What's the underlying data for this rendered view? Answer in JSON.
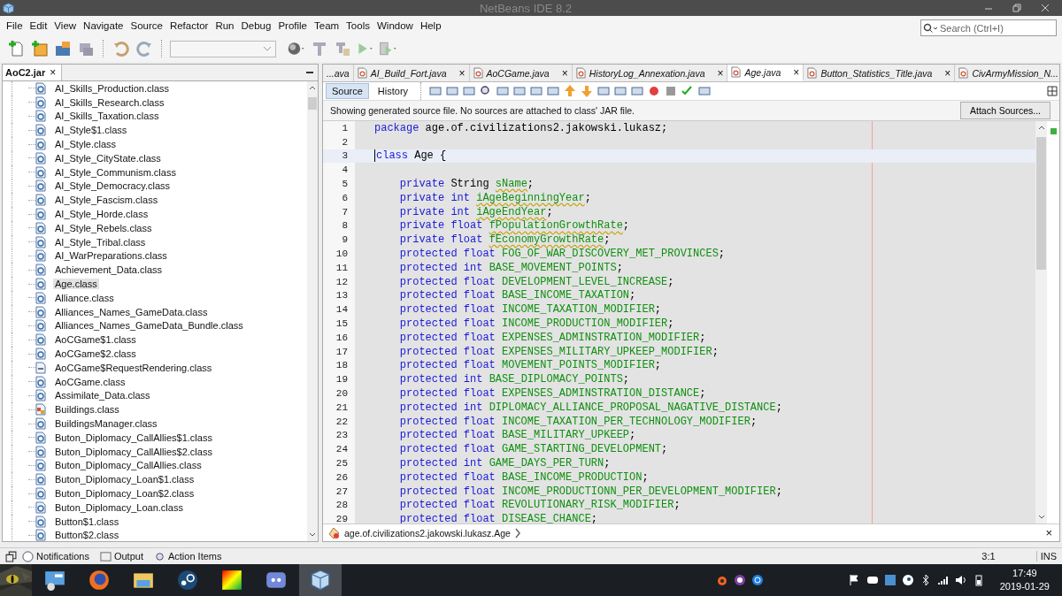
{
  "window": {
    "title": "NetBeans IDE 8.2"
  },
  "menu": [
    "File",
    "Edit",
    "View",
    "Navigate",
    "Source",
    "Refactor",
    "Run",
    "Debug",
    "Profile",
    "Team",
    "Tools",
    "Window",
    "Help"
  ],
  "search": {
    "placeholder": "Search (Ctrl+I)"
  },
  "project_panel": {
    "tab": "AoC2.jar",
    "close": "×",
    "items": [
      {
        "label": "AI_Skills_Production.class",
        "kind": "class",
        "selected": false
      },
      {
        "label": "AI_Skills_Research.class",
        "kind": "class",
        "selected": false
      },
      {
        "label": "AI_Skills_Taxation.class",
        "kind": "class",
        "selected": false
      },
      {
        "label": "AI_Style$1.class",
        "kind": "class",
        "selected": false
      },
      {
        "label": "AI_Style.class",
        "kind": "class",
        "selected": false
      },
      {
        "label": "AI_Style_CityState.class",
        "kind": "class",
        "selected": false
      },
      {
        "label": "AI_Style_Communism.class",
        "kind": "class",
        "selected": false
      },
      {
        "label": "AI_Style_Democracy.class",
        "kind": "class",
        "selected": false
      },
      {
        "label": "AI_Style_Fascism.class",
        "kind": "class",
        "selected": false
      },
      {
        "label": "AI_Style_Horde.class",
        "kind": "class",
        "selected": false
      },
      {
        "label": "AI_Style_Rebels.class",
        "kind": "class",
        "selected": false
      },
      {
        "label": "AI_Style_Tribal.class",
        "kind": "class",
        "selected": false
      },
      {
        "label": "AI_WarPreparations.class",
        "kind": "class",
        "selected": false
      },
      {
        "label": "Achievement_Data.class",
        "kind": "class",
        "selected": false
      },
      {
        "label": "Age.class",
        "kind": "class",
        "selected": true
      },
      {
        "label": "Alliance.class",
        "kind": "class",
        "selected": false
      },
      {
        "label": "Alliances_Names_GameData.class",
        "kind": "class",
        "selected": false
      },
      {
        "label": "Alliances_Names_GameData_Bundle.class",
        "kind": "class",
        "selected": false
      },
      {
        "label": "AoCGame$1.class",
        "kind": "class",
        "selected": false
      },
      {
        "label": "AoCGame$2.class",
        "kind": "class",
        "selected": false
      },
      {
        "label": "AoCGame$RequestRendering.class",
        "kind": "interface",
        "selected": false
      },
      {
        "label": "AoCGame.class",
        "kind": "class",
        "selected": false
      },
      {
        "label": "Assimilate_Data.class",
        "kind": "class",
        "selected": false
      },
      {
        "label": "Buildings.class",
        "kind": "enum",
        "selected": false
      },
      {
        "label": "BuildingsManager.class",
        "kind": "class",
        "selected": false
      },
      {
        "label": "Buton_Diplomacy_CallAllies$1.class",
        "kind": "class",
        "selected": false
      },
      {
        "label": "Buton_Diplomacy_CallAllies$2.class",
        "kind": "class",
        "selected": false
      },
      {
        "label": "Buton_Diplomacy_CallAllies.class",
        "kind": "class",
        "selected": false
      },
      {
        "label": "Buton_Diplomacy_Loan$1.class",
        "kind": "class",
        "selected": false
      },
      {
        "label": "Buton_Diplomacy_Loan$2.class",
        "kind": "class",
        "selected": false
      },
      {
        "label": "Buton_Diplomacy_Loan.class",
        "kind": "class",
        "selected": false
      },
      {
        "label": "Button$1.class",
        "kind": "class",
        "selected": false
      },
      {
        "label": "Button$2.class",
        "kind": "class",
        "selected": false
      }
    ]
  },
  "editor": {
    "tabs": [
      {
        "label": "...ava",
        "file": false,
        "selected": false
      },
      {
        "label": "AI_Build_Fort.java",
        "file": true,
        "selected": false
      },
      {
        "label": "AoCGame.java",
        "file": true,
        "selected": false
      },
      {
        "label": "HistoryLog_Annexation.java",
        "file": true,
        "selected": false
      },
      {
        "label": "Age.java",
        "file": true,
        "selected": true
      },
      {
        "label": "Button_Statistics_Title.java",
        "file": true,
        "selected": false
      },
      {
        "label": "CivArmyMission_N...",
        "file": true,
        "selected": false
      }
    ],
    "tab_close": "×",
    "views": [
      {
        "label": "Source",
        "selected": true
      },
      {
        "label": "History",
        "selected": false
      }
    ],
    "notice": "Showing generated source file. No sources are attached to class' JAR file.",
    "attach_button": "Attach Sources...",
    "lines": [
      {
        "num": "1",
        "indented": false,
        "current": false,
        "tokens": [
          {
            "kind": "keyword",
            "text": "package "
          },
          {
            "kind": "plain",
            "text": "age.of.civilizations2.jakowski.lukasz;"
          }
        ]
      },
      {
        "num": "2",
        "current": false
      },
      {
        "num": "3",
        "indented": false,
        "current": true,
        "tokens": [
          {
            "kind": "keyword",
            "text": "class "
          },
          {
            "kind": "plain",
            "text": "Age {"
          }
        ]
      },
      {
        "num": "4",
        "current": false
      },
      {
        "num": "5",
        "indented": true,
        "current": false,
        "tokens": [
          {
            "kind": "keyword",
            "text": "private "
          },
          {
            "kind": "plain",
            "text": "String "
          },
          {
            "kind": "field",
            "text": "sName",
            "warning": true
          },
          {
            "kind": "plain",
            "text": ";"
          }
        ]
      },
      {
        "num": "6",
        "indented": true,
        "current": false,
        "tokens": [
          {
            "kind": "keyword",
            "text": "private int "
          },
          {
            "kind": "field",
            "text": "iAgeBeginningYear",
            "warning": true
          },
          {
            "kind": "plain",
            "text": ";"
          }
        ]
      },
      {
        "num": "7",
        "indented": true,
        "current": false,
        "tokens": [
          {
            "kind": "keyword",
            "text": "private int "
          },
          {
            "kind": "field",
            "text": "iAgeEndYear",
            "warning": true
          },
          {
            "kind": "plain",
            "text": ";"
          }
        ]
      },
      {
        "num": "8",
        "indented": true,
        "current": false,
        "tokens": [
          {
            "kind": "keyword",
            "text": "private float "
          },
          {
            "kind": "field",
            "text": "fPopulationGrowthRate",
            "warning": true
          },
          {
            "kind": "plain",
            "text": ";"
          }
        ]
      },
      {
        "num": "9",
        "indented": true,
        "current": false,
        "tokens": [
          {
            "kind": "keyword",
            "text": "private float "
          },
          {
            "kind": "field",
            "text": "fEconomyGrowthRate",
            "warning": true
          },
          {
            "kind": "plain",
            "text": ";"
          }
        ]
      },
      {
        "num": "10",
        "indented": true,
        "current": false,
        "tokens": [
          {
            "kind": "keyword",
            "text": "protected float "
          },
          {
            "kind": "field",
            "text": "FOG_OF_WAR_DISCOVERY_MET_PROVINCES",
            "warning": false
          },
          {
            "kind": "plain",
            "text": ";"
          }
        ]
      },
      {
        "num": "11",
        "indented": true,
        "current": false,
        "tokens": [
          {
            "kind": "keyword",
            "text": "protected int "
          },
          {
            "kind": "field",
            "text": "BASE_MOVEMENT_POINTS",
            "warning": false
          },
          {
            "kind": "plain",
            "text": ";"
          }
        ]
      },
      {
        "num": "12",
        "indented": true,
        "current": false,
        "tokens": [
          {
            "kind": "keyword",
            "text": "protected float "
          },
          {
            "kind": "field",
            "text": "DEVELOPMENT_LEVEL_INCREASE",
            "warning": false
          },
          {
            "kind": "plain",
            "text": ";"
          }
        ]
      },
      {
        "num": "13",
        "indented": true,
        "current": false,
        "tokens": [
          {
            "kind": "keyword",
            "text": "protected float "
          },
          {
            "kind": "field",
            "text": "BASE_INCOME_TAXATION",
            "warning": false
          },
          {
            "kind": "plain",
            "text": ";"
          }
        ]
      },
      {
        "num": "14",
        "indented": true,
        "current": false,
        "tokens": [
          {
            "kind": "keyword",
            "text": "protected float "
          },
          {
            "kind": "field",
            "text": "INCOME_TAXATION_MODIFIER",
            "warning": false
          },
          {
            "kind": "plain",
            "text": ";"
          }
        ]
      },
      {
        "num": "15",
        "indented": true,
        "current": false,
        "tokens": [
          {
            "kind": "keyword",
            "text": "protected float "
          },
          {
            "kind": "field",
            "text": "INCOME_PRODUCTION_MODIFIER",
            "warning": false
          },
          {
            "kind": "plain",
            "text": ";"
          }
        ]
      },
      {
        "num": "16",
        "indented": true,
        "current": false,
        "tokens": [
          {
            "kind": "keyword",
            "text": "protected float "
          },
          {
            "kind": "field",
            "text": "EXPENSES_ADMINSTRATION_MODIFIER",
            "warning": false
          },
          {
            "kind": "plain",
            "text": ";"
          }
        ]
      },
      {
        "num": "17",
        "indented": true,
        "current": false,
        "tokens": [
          {
            "kind": "keyword",
            "text": "protected float "
          },
          {
            "kind": "field",
            "text": "EXPENSES_MILITARY_UPKEEP_MODIFIER",
            "warning": false
          },
          {
            "kind": "plain",
            "text": ";"
          }
        ]
      },
      {
        "num": "18",
        "indented": true,
        "current": false,
        "tokens": [
          {
            "kind": "keyword",
            "text": "protected float "
          },
          {
            "kind": "field",
            "text": "MOVEMENT_POINTS_MODIFIER",
            "warning": false
          },
          {
            "kind": "plain",
            "text": ";"
          }
        ]
      },
      {
        "num": "19",
        "indented": true,
        "current": false,
        "tokens": [
          {
            "kind": "keyword",
            "text": "protected int "
          },
          {
            "kind": "field",
            "text": "BASE_DIPLOMACY_POINTS",
            "warning": false
          },
          {
            "kind": "plain",
            "text": ";"
          }
        ]
      },
      {
        "num": "20",
        "indented": true,
        "current": false,
        "tokens": [
          {
            "kind": "keyword",
            "text": "protected float "
          },
          {
            "kind": "field",
            "text": "EXPENSES_ADMINSTRATION_DISTANCE",
            "warning": false
          },
          {
            "kind": "plain",
            "text": ";"
          }
        ]
      },
      {
        "num": "21",
        "indented": true,
        "current": false,
        "tokens": [
          {
            "kind": "keyword",
            "text": "protected int "
          },
          {
            "kind": "field",
            "text": "DIPLOMACY_ALLIANCE_PROPOSAL_NAGATIVE_DISTANCE",
            "warning": false
          },
          {
            "kind": "plain",
            "text": ";"
          }
        ]
      },
      {
        "num": "22",
        "indented": true,
        "current": false,
        "tokens": [
          {
            "kind": "keyword",
            "text": "protected float "
          },
          {
            "kind": "field",
            "text": "INCOME_TAXATION_PER_TECHNOLOGY_MODIFIER",
            "warning": false
          },
          {
            "kind": "plain",
            "text": ";"
          }
        ]
      },
      {
        "num": "23",
        "indented": true,
        "current": false,
        "tokens": [
          {
            "kind": "keyword",
            "text": "protected float "
          },
          {
            "kind": "field",
            "text": "BASE_MILITARY_UPKEEP",
            "warning": false
          },
          {
            "kind": "plain",
            "text": ";"
          }
        ]
      },
      {
        "num": "24",
        "indented": true,
        "current": false,
        "tokens": [
          {
            "kind": "keyword",
            "text": "protected float "
          },
          {
            "kind": "field",
            "text": "GAME_STARTING_DEVELOPMENT",
            "warning": false
          },
          {
            "kind": "plain",
            "text": ";"
          }
        ]
      },
      {
        "num": "25",
        "indented": true,
        "current": false,
        "tokens": [
          {
            "kind": "keyword",
            "text": "protected int "
          },
          {
            "kind": "field",
            "text": "GAME_DAYS_PER_TURN",
            "warning": false
          },
          {
            "kind": "plain",
            "text": ";"
          }
        ]
      },
      {
        "num": "26",
        "indented": true,
        "current": false,
        "tokens": [
          {
            "kind": "keyword",
            "text": "protected float "
          },
          {
            "kind": "field",
            "text": "BASE_INCOME_PRODUCTION",
            "warning": false
          },
          {
            "kind": "plain",
            "text": ";"
          }
        ]
      },
      {
        "num": "27",
        "indented": true,
        "current": false,
        "tokens": [
          {
            "kind": "keyword",
            "text": "protected float "
          },
          {
            "kind": "field",
            "text": "INCOME_PRODUCTIONN_PER_DEVELOPMENT_MODIFIER",
            "warning": false
          },
          {
            "kind": "plain",
            "text": ";"
          }
        ]
      },
      {
        "num": "28",
        "indented": true,
        "current": false,
        "tokens": [
          {
            "kind": "keyword",
            "text": "protected float "
          },
          {
            "kind": "field",
            "text": "REVOLUTIONARY_RISK_MODIFIER",
            "warning": false
          },
          {
            "kind": "plain",
            "text": ";"
          }
        ]
      },
      {
        "num": "29",
        "indented": true,
        "current": false,
        "tokens": [
          {
            "kind": "keyword",
            "text": "protected float "
          },
          {
            "kind": "field",
            "text": "DISEASE_CHANCE",
            "warning": false
          },
          {
            "kind": "plain",
            "text": ";"
          }
        ]
      }
    ],
    "breadcrumb": "age.of.civilizations2.jakowski.lukasz.Age",
    "breadcrumb_close": "×"
  },
  "bottom_bar": {
    "tabs": [
      "Notifications",
      "Output",
      "Action Items"
    ],
    "position": "3:1",
    "mode": "INS"
  },
  "taskbar": {
    "apps": [
      {
        "kind": "panel",
        "selected": false
      },
      {
        "kind": "firefox",
        "selected": false
      },
      {
        "kind": "folder",
        "selected": false
      },
      {
        "kind": "steam",
        "selected": false
      },
      {
        "kind": "gradient",
        "selected": false
      },
      {
        "kind": "discord",
        "selected": false
      },
      {
        "kind": "cube",
        "selected": true
      }
    ],
    "time": "17:49",
    "date": "2019-01-29"
  }
}
